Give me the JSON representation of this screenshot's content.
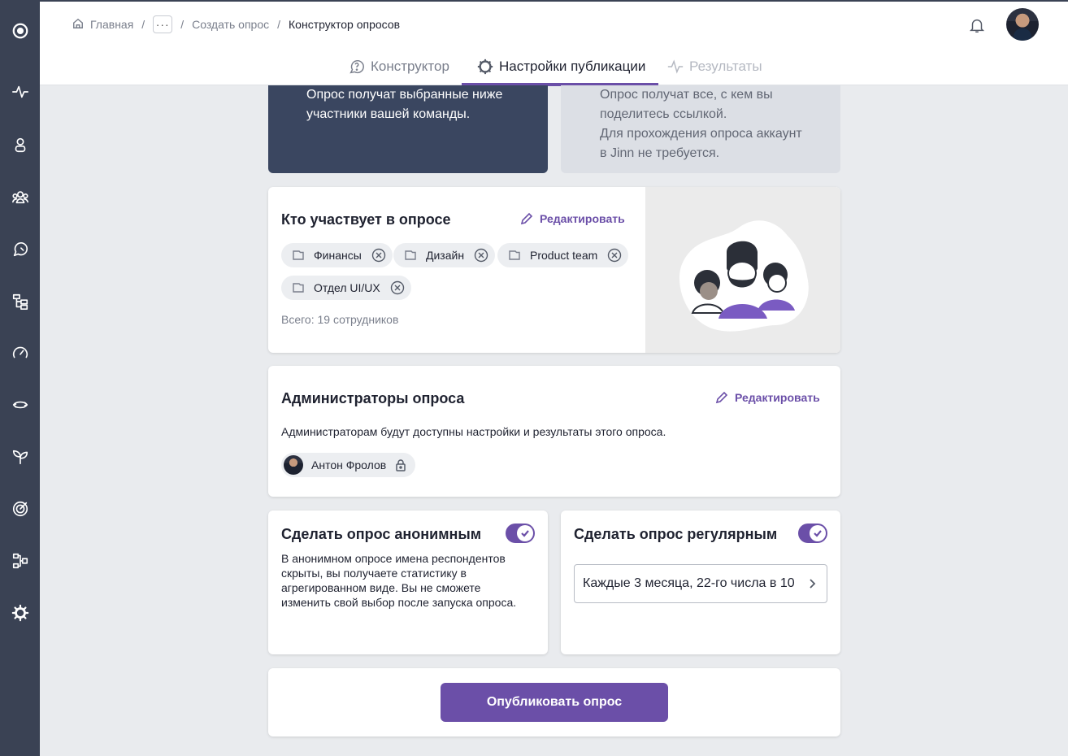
{
  "breadcrumb": {
    "home": "Главная",
    "more": "···",
    "create": "Создать опрос",
    "current": "Конструктор опросов"
  },
  "tabs": [
    {
      "label": "Конструктор",
      "icon": "question-bubble-icon",
      "state": "normal"
    },
    {
      "label": "Настройки публикации",
      "icon": "gear-icon",
      "state": "active"
    },
    {
      "label": "Результаты",
      "icon": "pulse-icon",
      "state": "disabled"
    }
  ],
  "audience": {
    "team_text": "Опрос получат выбранные ниже\nучастники вашей команды.",
    "link_text": "Опрос получат все, с кем вы\nподелитесь ссылкой.\nДля прохождения опроса аккаунт\nв Jinn не требуется."
  },
  "participants": {
    "title": "Кто участвует в опросе",
    "edit_label": "Редактировать",
    "chips": [
      "Финансы",
      "Дизайн",
      "Product team",
      "Отдел UI/UX"
    ],
    "total": "Всего: 19 сотрудников"
  },
  "admins": {
    "title": "Администраторы опроса",
    "edit_label": "Редактировать",
    "description": "Администраторам будут доступны настройки и результаты этого опроса.",
    "person": "Антон Фролов"
  },
  "anonymous": {
    "title": "Сделать опрос анонимным",
    "enabled": true,
    "description": "В анонимном опросе имена респондентов скрыты, вы получаете статистику в агрегированном виде. Вы не сможете изменить свой выбор после запуска опроса."
  },
  "regular": {
    "title": "Сделать опрос регулярным",
    "enabled": true,
    "schedule": "Каждые 3 месяца, 22-го числа в 10"
  },
  "publish_label": "Опубликовать опрос",
  "colors": {
    "accent": "#6b4fa8",
    "sidebar": "#3a4254",
    "dark_option": "#3a4660"
  },
  "sidebar_icons": [
    "logo-icon",
    "pulse-icon",
    "person-icon",
    "team-icon",
    "feedback-icon",
    "org-structure-icon",
    "speedometer-icon",
    "sync-icon",
    "growth-icon",
    "target-icon",
    "workflow-icon",
    "settings-gear-icon"
  ]
}
